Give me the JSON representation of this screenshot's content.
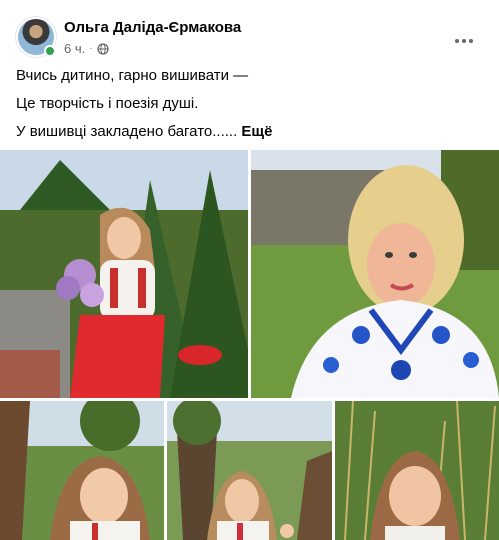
{
  "post": {
    "author": "Ольга Даліда-Єрмакова",
    "time": "6 ч.",
    "separator": "·",
    "text_lines": [
      "Вчись дитино, гарно вишивати —",
      "Це творчість і поезія душі.",
      "У вишивці закладено багато......"
    ],
    "see_more": "Ещё"
  },
  "icons": {
    "globe": "globe-icon",
    "more": "more-horizontal-icon"
  },
  "colors": {
    "text": "#050505",
    "secondary": "#65676b",
    "online": "#31a24c"
  },
  "photos": [
    {
      "name": "photo-girl-with-lilac"
    },
    {
      "name": "photo-woman-selfie"
    },
    {
      "name": "photo-girl-tree-left"
    },
    {
      "name": "photo-girl-tree-center"
    },
    {
      "name": "photo-girl-grass"
    }
  ]
}
